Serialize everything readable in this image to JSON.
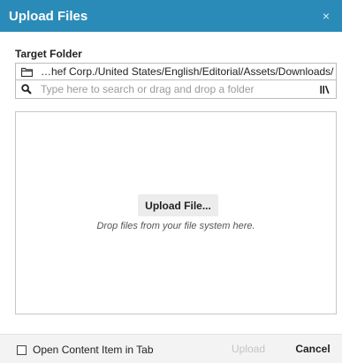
{
  "dialog": {
    "title": "Upload Files",
    "close_glyph": "×",
    "close_icon": "close-icon"
  },
  "target": {
    "label": "Target Folder",
    "path_icon": "folder-icon",
    "path": "…hef Corp./United States/English/Editorial/Assets/Downloads/",
    "search_icon": "search-icon",
    "search_placeholder": "Type here to search or drag and drop a folder",
    "search_value": "",
    "browse_icon": "library-browse-icon"
  },
  "dropzone": {
    "button_label": "Upload File...",
    "hint": "Drop files from your file system here."
  },
  "footer": {
    "open_in_tab_label": "Open Content Item in Tab",
    "open_in_tab_checked": false,
    "upload_label": "Upload",
    "upload_enabled": false,
    "cancel_label": "Cancel"
  },
  "colors": {
    "header": "#2a8bb8",
    "disabled_text": "#c4c4c4"
  }
}
